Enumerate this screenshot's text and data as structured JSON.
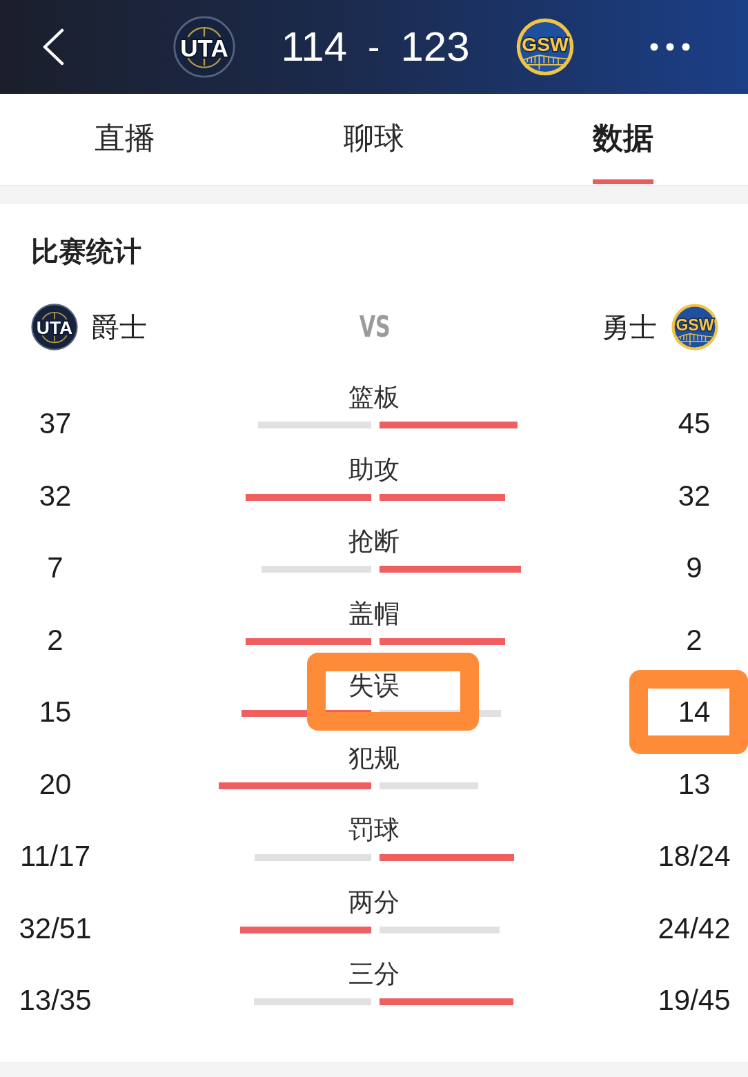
{
  "header": {
    "home_logo": "UTA",
    "home_score": "114",
    "separator": "-",
    "away_score": "123",
    "away_logo": "GSW"
  },
  "tabs": [
    {
      "label": "直播",
      "selected": false
    },
    {
      "label": "聊球",
      "selected": false
    },
    {
      "label": "数据",
      "selected": true
    }
  ],
  "stats_panel": {
    "title": "比赛统计",
    "home_team": {
      "logo": "UTA",
      "name": "爵士"
    },
    "versus": "VS",
    "away_team": {
      "name": "勇士",
      "logo": "GSW"
    },
    "stats": [
      {
        "label": "篮板",
        "home": "37",
        "away": "45",
        "home_bar": {
          "level": 0.451,
          "leading": false
        },
        "away_bar": {
          "level": 0.549,
          "leading": true
        },
        "label_circled": false,
        "away_circled": false
      },
      {
        "label": "助攻",
        "home": "32",
        "away": "32",
        "home_bar": {
          "level": 0.5,
          "leading": true
        },
        "away_bar": {
          "level": 0.5,
          "leading": true
        },
        "label_circled": false,
        "away_circled": false
      },
      {
        "label": "抢断",
        "home": "7",
        "away": "9",
        "home_bar": {
          "level": 0.438,
          "leading": false
        },
        "away_bar": {
          "level": 0.562,
          "leading": true
        },
        "label_circled": false,
        "away_circled": false
      },
      {
        "label": "盖帽",
        "home": "2",
        "away": "2",
        "home_bar": {
          "level": 0.5,
          "leading": true
        },
        "away_bar": {
          "level": 0.5,
          "leading": true
        },
        "label_circled": false,
        "away_circled": false
      },
      {
        "label": "失误",
        "home": "15",
        "away": "14",
        "home_bar": {
          "level": 0.517,
          "leading": true
        },
        "away_bar": {
          "level": 0.483,
          "leading": false
        },
        "label_circled": true,
        "away_circled": true
      },
      {
        "label": "犯规",
        "home": "20",
        "away": "13",
        "home_bar": {
          "level": 0.606,
          "leading": true
        },
        "away_bar": {
          "level": 0.394,
          "leading": false
        },
        "label_circled": false,
        "away_circled": false
      },
      {
        "label": "罚球",
        "home": "11/17",
        "away": "18/24",
        "home_bar": {
          "level": 0.463,
          "leading": false
        },
        "away_bar": {
          "level": 0.537,
          "leading": true
        },
        "label_circled": false,
        "away_circled": false
      },
      {
        "label": "两分",
        "home": "32/51",
        "away": "24/42",
        "home_bar": {
          "level": 0.523,
          "leading": true
        },
        "away_bar": {
          "level": 0.477,
          "leading": false
        },
        "label_circled": false,
        "away_circled": false
      },
      {
        "label": "三分",
        "home": "13/35",
        "away": "19/45",
        "home_bar": {
          "level": 0.468,
          "leading": false
        },
        "away_bar": {
          "level": 0.532,
          "leading": true
        },
        "label_circled": false,
        "away_circled": false
      }
    ]
  }
}
